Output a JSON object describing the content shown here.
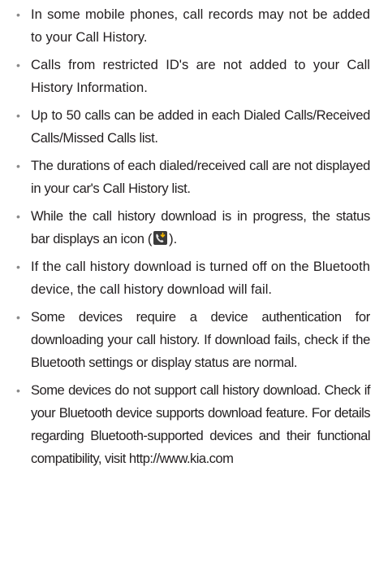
{
  "bullets": [
    {
      "text": "In some mobile phones, call records may not be added to your Call History."
    },
    {
      "text": "Calls from restricted ID's are not added to your Call History Information."
    },
    {
      "text": "Up to 50 calls can be added in each Dialed Calls/Received Calls/Missed Calls list."
    },
    {
      "text": "The durations of each dialed/received call are not displayed in your car's Call History list."
    },
    {
      "text_before_icon": "While the call history download is in progress, the status bar displays an icon (",
      "icon": "call-history-download-icon",
      "text_after_icon": ")."
    },
    {
      "text": "If the call history download is turned off on the Bluetooth device, the call history download will fail."
    },
    {
      "text": "Some devices require a device authentication for downloading your call history. If download fails, check if the Bluetooth settings or display status are normal."
    },
    {
      "text": "Some devices do not support call history download. Check if your Bluetooth device supports download feature. For details regarding Bluetooth-supported devices and their functional compatibility, visit http://www.kia.com"
    }
  ],
  "bullet_symbol": "•",
  "colors": {
    "text": "#231f20",
    "bullet": "#8a8a8a",
    "icon_bg": "#3b3b3b"
  }
}
